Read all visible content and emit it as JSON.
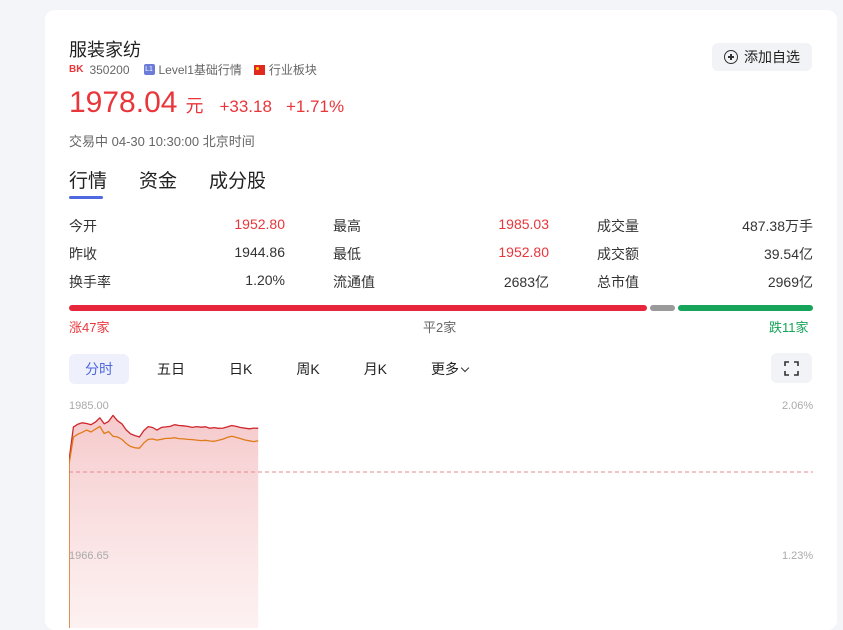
{
  "header": {
    "title": "服装家纺",
    "badge": "BK",
    "code": "350200",
    "level_icon": "L1",
    "level": "Level1基础行情",
    "sector": "行业板块",
    "add_watch": "添加自选"
  },
  "quote": {
    "price": "1978.04",
    "unit": "元",
    "change": "+33.18",
    "change_pct": "+1.71%",
    "status": "交易中 04-30 10:30:00 北京时间"
  },
  "tabs": [
    "行情",
    "资金",
    "成分股"
  ],
  "stats": [
    {
      "label": "今开",
      "value": "1952.80",
      "color": "#e8363b"
    },
    {
      "label": "最高",
      "value": "1985.03",
      "color": "#e8363b"
    },
    {
      "label": "成交量",
      "value": "487.38万手",
      "color": "#333333"
    },
    {
      "label": "昨收",
      "value": "1944.86",
      "color": "#333333"
    },
    {
      "label": "最低",
      "value": "1952.80",
      "color": "#e8363b"
    },
    {
      "label": "成交额",
      "value": "39.54亿",
      "color": "#333333"
    },
    {
      "label": "换手率",
      "value": "1.20%",
      "color": "#333333"
    },
    {
      "label": "流通值",
      "value": "2683亿",
      "color": "#333333"
    },
    {
      "label": "总市值",
      "value": "2969亿",
      "color": "#333333"
    }
  ],
  "breadth": {
    "up_label": "涨47家",
    "flat_label": "平2家",
    "down_label": "跌11家",
    "up_count": 47,
    "flat_count": 2,
    "down_count": 11,
    "up_color": "#e8263b",
    "flat_color": "#9a9a9a",
    "down_color": "#16a35a"
  },
  "periods": [
    "分时",
    "五日",
    "日K",
    "周K",
    "月K",
    "更多"
  ],
  "chart_axis": {
    "left_top": "1985.00",
    "left_mid": "1966.65",
    "right_top": "2.06%",
    "right_mid": "1.23%"
  },
  "chart_data": {
    "type": "line",
    "ylim": [
      1944.86,
      1985.0
    ],
    "reference": 1944.86,
    "series": [
      {
        "color": "#d0262c",
        "values": [
          1952.8,
          1976.5,
          1978.5,
          1979.5,
          1979.0,
          1978.2,
          1980.0,
          1983.0,
          1978.8,
          1980.5,
          1984.7,
          1981.0,
          1978.8,
          1974.5,
          1971.7,
          1970.5,
          1969.5,
          1974.0,
          1976.8,
          1976.2,
          1974.4,
          1976.3,
          1976.6,
          1977.0,
          1978.2,
          1977.6,
          1977.4,
          1977.0,
          1976.3,
          1976.8,
          1976.4,
          1976.7,
          1975.7,
          1976.1,
          1975.6,
          1975.8,
          1976.6,
          1977.6,
          1977.0,
          1976.2,
          1975.7,
          1975.3,
          1975.8,
          1975.6
        ]
      },
      {
        "color": "#e07b1a",
        "values": [
          1950.2,
          1969.4,
          1971.5,
          1972.8,
          1974.4,
          1973.0,
          1975.0,
          1977.0,
          1972.0,
          1973.3,
          1970.0,
          1969.6,
          1967.9,
          1964.9,
          1962.8,
          1961.9,
          1961.6,
          1965.3,
          1967.8,
          1968.1,
          1967.3,
          1967.9,
          1968.5,
          1968.5,
          1969.0,
          1968.4,
          1968.2,
          1967.8,
          1967.7,
          1967.3,
          1967.0,
          1967.2,
          1966.7,
          1966.5,
          1967.2,
          1968.0,
          1969.2,
          1970.0,
          1969.2,
          1968.4,
          1967.4,
          1966.8,
          1966.3,
          1966.9
        ]
      }
    ]
  }
}
